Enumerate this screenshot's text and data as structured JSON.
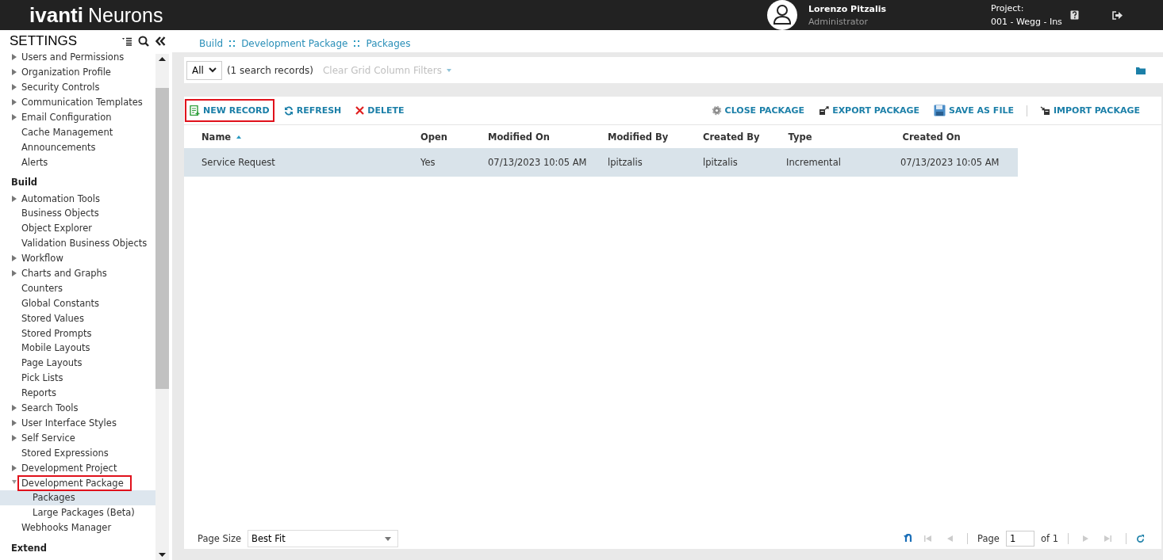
{
  "header": {
    "brand": "ivanti",
    "product": "Neurons",
    "user": {
      "name": "Lorenzo Pitzalis",
      "role": "Administrator"
    },
    "project": {
      "label": "Project:",
      "value": "001 - Wegg - Ins"
    }
  },
  "sidebar": {
    "title": "SETTINGS",
    "groups": [
      {
        "items": [
          {
            "label": "Users and Permissions",
            "kind": "folder",
            "expanded": false,
            "selected": false,
            "highlighted": false
          },
          {
            "label": "Organization Profile",
            "kind": "folder",
            "expanded": false,
            "selected": false,
            "highlighted": false
          },
          {
            "label": "Security Controls",
            "kind": "folder",
            "expanded": false,
            "selected": false,
            "highlighted": false
          },
          {
            "label": "Communication Templates",
            "kind": "folder",
            "expanded": false,
            "selected": false,
            "highlighted": false
          },
          {
            "label": "Email Configuration",
            "kind": "folder",
            "expanded": false,
            "selected": false,
            "highlighted": false
          },
          {
            "label": "Cache Management",
            "kind": "page",
            "selected": false,
            "highlighted": false
          },
          {
            "label": "Announcements",
            "kind": "page",
            "selected": false,
            "highlighted": false
          },
          {
            "label": "Alerts",
            "kind": "page",
            "selected": false,
            "highlighted": false
          }
        ]
      },
      {
        "heading": "Build",
        "items": [
          {
            "label": "Automation Tools",
            "kind": "folder",
            "expanded": false,
            "selected": false,
            "highlighted": false
          },
          {
            "label": "Business Objects",
            "kind": "page",
            "selected": false,
            "highlighted": false
          },
          {
            "label": "Object Explorer",
            "kind": "page",
            "selected": false,
            "highlighted": false
          },
          {
            "label": "Validation Business Objects",
            "kind": "page",
            "selected": false,
            "highlighted": false
          },
          {
            "label": "Workflow",
            "kind": "folder",
            "expanded": false,
            "selected": false,
            "highlighted": false
          },
          {
            "label": "Charts and Graphs",
            "kind": "folder",
            "expanded": false,
            "selected": false,
            "highlighted": false
          },
          {
            "label": "Counters",
            "kind": "page",
            "selected": false,
            "highlighted": false
          },
          {
            "label": "Global Constants",
            "kind": "page",
            "selected": false,
            "highlighted": false
          },
          {
            "label": "Stored Values",
            "kind": "page",
            "selected": false,
            "highlighted": false
          },
          {
            "label": "Stored Prompts",
            "kind": "page",
            "selected": false,
            "highlighted": false
          },
          {
            "label": "Mobile Layouts",
            "kind": "page",
            "selected": false,
            "highlighted": false
          },
          {
            "label": "Page Layouts",
            "kind": "page",
            "selected": false,
            "highlighted": false
          },
          {
            "label": "Pick Lists",
            "kind": "page",
            "selected": false,
            "highlighted": false
          },
          {
            "label": "Reports",
            "kind": "page",
            "selected": false,
            "highlighted": false
          },
          {
            "label": "Search Tools",
            "kind": "folder",
            "expanded": false,
            "selected": false,
            "highlighted": false
          },
          {
            "label": "User Interface Styles",
            "kind": "folder",
            "expanded": false,
            "selected": false,
            "highlighted": false
          },
          {
            "label": "Self Service",
            "kind": "folder",
            "expanded": false,
            "selected": false,
            "highlighted": false
          },
          {
            "label": "Stored Expressions",
            "kind": "page",
            "selected": false,
            "highlighted": false
          },
          {
            "label": "Development Project",
            "kind": "folder",
            "expanded": false,
            "selected": false,
            "highlighted": false
          },
          {
            "label": "Development Package",
            "kind": "folder",
            "expanded": true,
            "selected": false,
            "highlighted": true,
            "children": [
              {
                "label": "Packages",
                "kind": "page",
                "selected": true,
                "highlighted": false
              },
              {
                "label": "Large Packages (Beta)",
                "kind": "page",
                "selected": false,
                "highlighted": false
              }
            ]
          },
          {
            "label": "Webhooks Manager",
            "kind": "page",
            "selected": false,
            "highlighted": false
          }
        ]
      },
      {
        "heading": "Extend"
      }
    ]
  },
  "breadcrumb": [
    "Build",
    "Development Package",
    "Packages"
  ],
  "filter_bar": {
    "scope": "All",
    "count": "(1 search records)",
    "clear": {
      "label": "Clear Grid Column Filters",
      "disabled": true
    }
  },
  "toolbar": {
    "left": [
      {
        "label": "NEW RECORD",
        "kind": "new",
        "highlighted": true
      },
      {
        "label": "REFRESH",
        "kind": "refresh",
        "highlighted": false
      },
      {
        "label": "DELETE",
        "kind": "delete",
        "highlighted": false
      }
    ],
    "right": [
      {
        "label": "CLOSE PACKAGE",
        "kind": "close"
      },
      {
        "label": "EXPORT PACKAGE",
        "kind": "export"
      },
      {
        "label": "SAVE AS FILE",
        "kind": "save"
      },
      {
        "label": "IMPORT PACKAGE",
        "kind": "import"
      }
    ]
  },
  "table": {
    "columns": [
      {
        "label": "Name",
        "sorted": true
      },
      {
        "label": "Open",
        "sorted": false
      },
      {
        "label": "Modified On",
        "sorted": false
      },
      {
        "label": "Modified By",
        "sorted": false
      },
      {
        "label": "Created By",
        "sorted": false
      },
      {
        "label": "Type",
        "sorted": false
      },
      {
        "label": "Created On",
        "sorted": false
      }
    ],
    "rows": [
      {
        "selected": true,
        "cells": [
          "Service Request",
          "Yes",
          "07/13/2023 10:05 AM",
          "lpitzalis",
          "lpitzalis",
          "Incremental",
          "07/13/2023 10:05 AM"
        ]
      }
    ]
  },
  "pager": {
    "page_size_label": "Page Size",
    "page_size": "Best Fit",
    "page_label": "Page",
    "page": "1",
    "of": "of 1"
  }
}
